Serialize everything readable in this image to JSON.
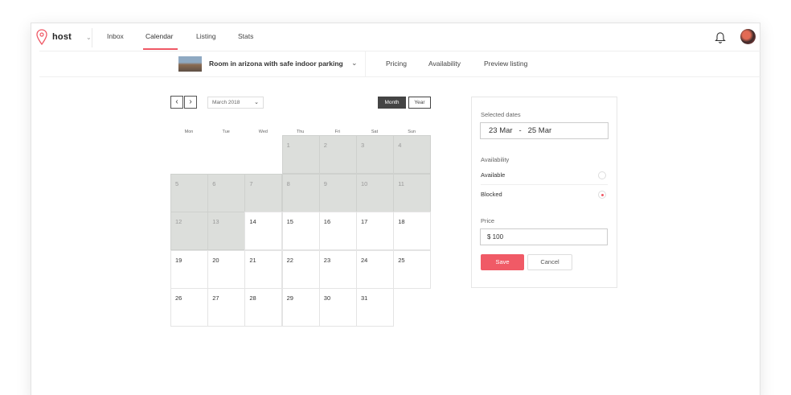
{
  "brand": {
    "name": "host"
  },
  "nav": {
    "items": [
      "Inbox",
      "Calendar",
      "Listing",
      "Stats"
    ],
    "active": "Calendar"
  },
  "listing": {
    "title": "Room in arizona with safe indoor parking",
    "tabs": [
      "Pricing",
      "Availability",
      "Preview listing"
    ]
  },
  "calendar": {
    "month_label": "March 2018",
    "view_buttons": {
      "month": "Month",
      "year": "Year"
    },
    "active_view": "Month",
    "weekdays": [
      "Mon",
      "Tue",
      "Wed",
      "Thu",
      "Fri",
      "Sat",
      "Sun"
    ],
    "days": [
      "1",
      "2",
      "3",
      "4",
      "5",
      "6",
      "7",
      "8",
      "9",
      "10",
      "11",
      "12",
      "13",
      "14",
      "15",
      "16",
      "17",
      "18",
      "19",
      "20",
      "21",
      "22",
      "23",
      "24",
      "25",
      "26",
      "27",
      "28",
      "29",
      "30",
      "31"
    ],
    "blocked_days": [
      "1",
      "2",
      "3",
      "4",
      "5",
      "6",
      "7",
      "8",
      "9",
      "10",
      "11",
      "12",
      "13"
    ]
  },
  "panel": {
    "selected_label": "Selected dates",
    "start_date": "23 Mar",
    "date_sep": "-",
    "end_date": "25 Mar",
    "availability_label": "Availability",
    "available_label": "Available",
    "blocked_label": "Blocked",
    "selected_option": "Blocked",
    "price_label": "Price",
    "price_value": "$ 100",
    "save": "Save",
    "cancel": "Cancel"
  },
  "colors": {
    "accent": "#ef5865",
    "blocked": "#dcdedb",
    "dark_button": "#444444"
  }
}
